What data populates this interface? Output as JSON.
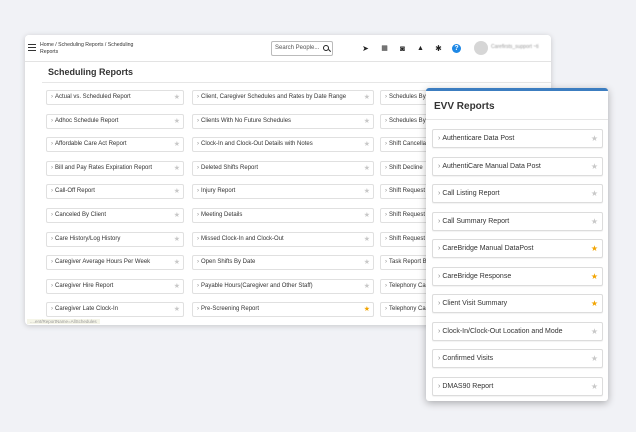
{
  "header": {
    "breadcrumb": "Home / Scheduling Reports / Scheduling Reports",
    "search_placeholder": "Search People...",
    "user_name": "Carefirsts_support ~ti"
  },
  "page": {
    "title": "Scheduling Reports",
    "footer_url": "....ent/ReportName=AllSchedules"
  },
  "columns": [
    [
      {
        "label": "Actual vs. Scheduled Report",
        "starred": false
      },
      {
        "label": "Adhoc Schedule Report",
        "starred": false
      },
      {
        "label": "Affordable Care Act Report",
        "starred": false
      },
      {
        "label": "Bill and Pay Rates Expiration Report",
        "starred": false
      },
      {
        "label": "Call-Off Report",
        "starred": false
      },
      {
        "label": "Canceled By Client",
        "starred": false
      },
      {
        "label": "Care History/Log History",
        "starred": false
      },
      {
        "label": "Caregiver Average Hours Per Week",
        "starred": false
      },
      {
        "label": "Caregiver Hire Report",
        "starred": false
      },
      {
        "label": "Caregiver Late Clock-In",
        "starred": false
      }
    ],
    [
      {
        "label": "Client, Caregiver Schedules and Rates by Date Range",
        "starred": false
      },
      {
        "label": "Clients With No Future Schedules",
        "starred": false
      },
      {
        "label": "Clock-In and Clock-Out Details with Notes",
        "starred": false
      },
      {
        "label": "Deleted Shifts Report",
        "starred": false
      },
      {
        "label": "Injury Report",
        "starred": false
      },
      {
        "label": "Meeting Details",
        "starred": false
      },
      {
        "label": "Missed Clock-In and Clock-Out",
        "starred": false
      },
      {
        "label": "Open Shifts By Date",
        "starred": false
      },
      {
        "label": "Payable Hours(Caregiver and Other Staff)",
        "starred": false
      },
      {
        "label": "Pre-Screening Report",
        "starred": true
      }
    ],
    [
      {
        "label": "Schedules By",
        "starred": false
      },
      {
        "label": "Schedules By",
        "starred": false
      },
      {
        "label": "Shift Cancella",
        "starred": false
      },
      {
        "label": "Shift Decline",
        "starred": false
      },
      {
        "label": "Shift Request",
        "starred": false
      },
      {
        "label": "Shift Request",
        "starred": false
      },
      {
        "label": "Shift Request",
        "starred": false
      },
      {
        "label": "Task Report B",
        "starred": false
      },
      {
        "label": "Telephony Ca",
        "starred": false
      },
      {
        "label": "Telephony Ca",
        "starred": false
      }
    ]
  ],
  "evv": {
    "title": "EVV Reports",
    "items": [
      {
        "label": "Authenticare Data Post",
        "starred": false
      },
      {
        "label": "AuthentiCare Manual Data Post",
        "starred": false
      },
      {
        "label": "Call Listing Report",
        "starred": false
      },
      {
        "label": "Call Summary Report",
        "starred": false
      },
      {
        "label": "CareBridge Manual DataPost",
        "starred": true
      },
      {
        "label": "CareBridge Response",
        "starred": true
      },
      {
        "label": "Client Visit Summary",
        "starred": true
      },
      {
        "label": "Clock-In/Clock-Out Location and Mode",
        "starred": false
      },
      {
        "label": "Confirmed Visits",
        "starred": false
      },
      {
        "label": "DMAS90 Report",
        "starred": false
      }
    ]
  },
  "icons": {
    "chevron": "›",
    "star": "★"
  },
  "colors": {
    "accent": "#3c7dc0",
    "star_on": "#f2a400",
    "help": "#1e88e5"
  }
}
